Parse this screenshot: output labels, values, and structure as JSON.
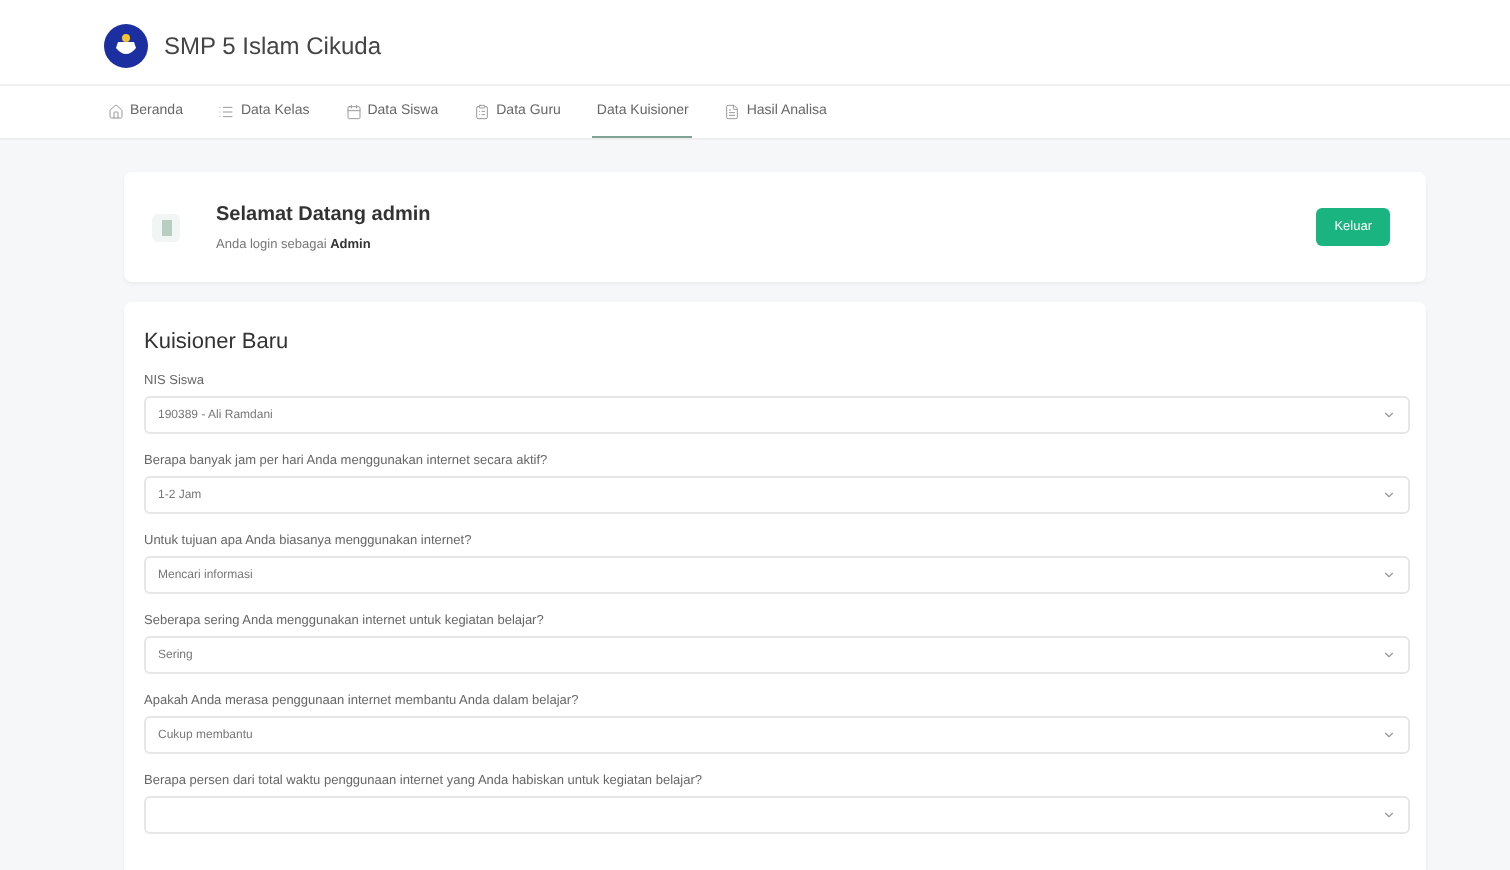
{
  "brand": {
    "title": "SMP 5 Islam Cikuda"
  },
  "tabs": [
    {
      "label": "Beranda",
      "selected": false
    },
    {
      "label": "Data Kelas",
      "selected": false
    },
    {
      "label": "Data Siswa",
      "selected": false
    },
    {
      "label": "Data Guru",
      "selected": false
    },
    {
      "label": "Data Kuisioner",
      "selected": true
    },
    {
      "label": "Hasil Analisa",
      "selected": false
    }
  ],
  "welcome": {
    "title": "Selamat Datang admin",
    "subtitle": "Anda login sebagai **Admin**",
    "button": "Keluar"
  },
  "form": {
    "title": "Kuisioner Baru",
    "fields": [
      {
        "label": "NIS Siswa",
        "value": "190389 - Ali Ramdani"
      },
      {
        "label": "Berapa banyak jam per hari Anda menggunakan internet secara aktif?",
        "value": "1-2 Jam"
      },
      {
        "label": "Untuk tujuan apa Anda biasanya menggunakan internet?",
        "value": "Mencari informasi"
      },
      {
        "label": "Seberapa sering Anda menggunakan internet untuk kegiatan belajar?",
        "value": "Sering"
      },
      {
        "label": "Apakah Anda merasa penggunaan internet membantu Anda dalam belajar?",
        "value": "Cukup membantu"
      },
      {
        "label": "Berapa persen dari total waktu penggunaan internet yang Anda habiskan untuk kegiatan belajar?"
      }
    ]
  }
}
